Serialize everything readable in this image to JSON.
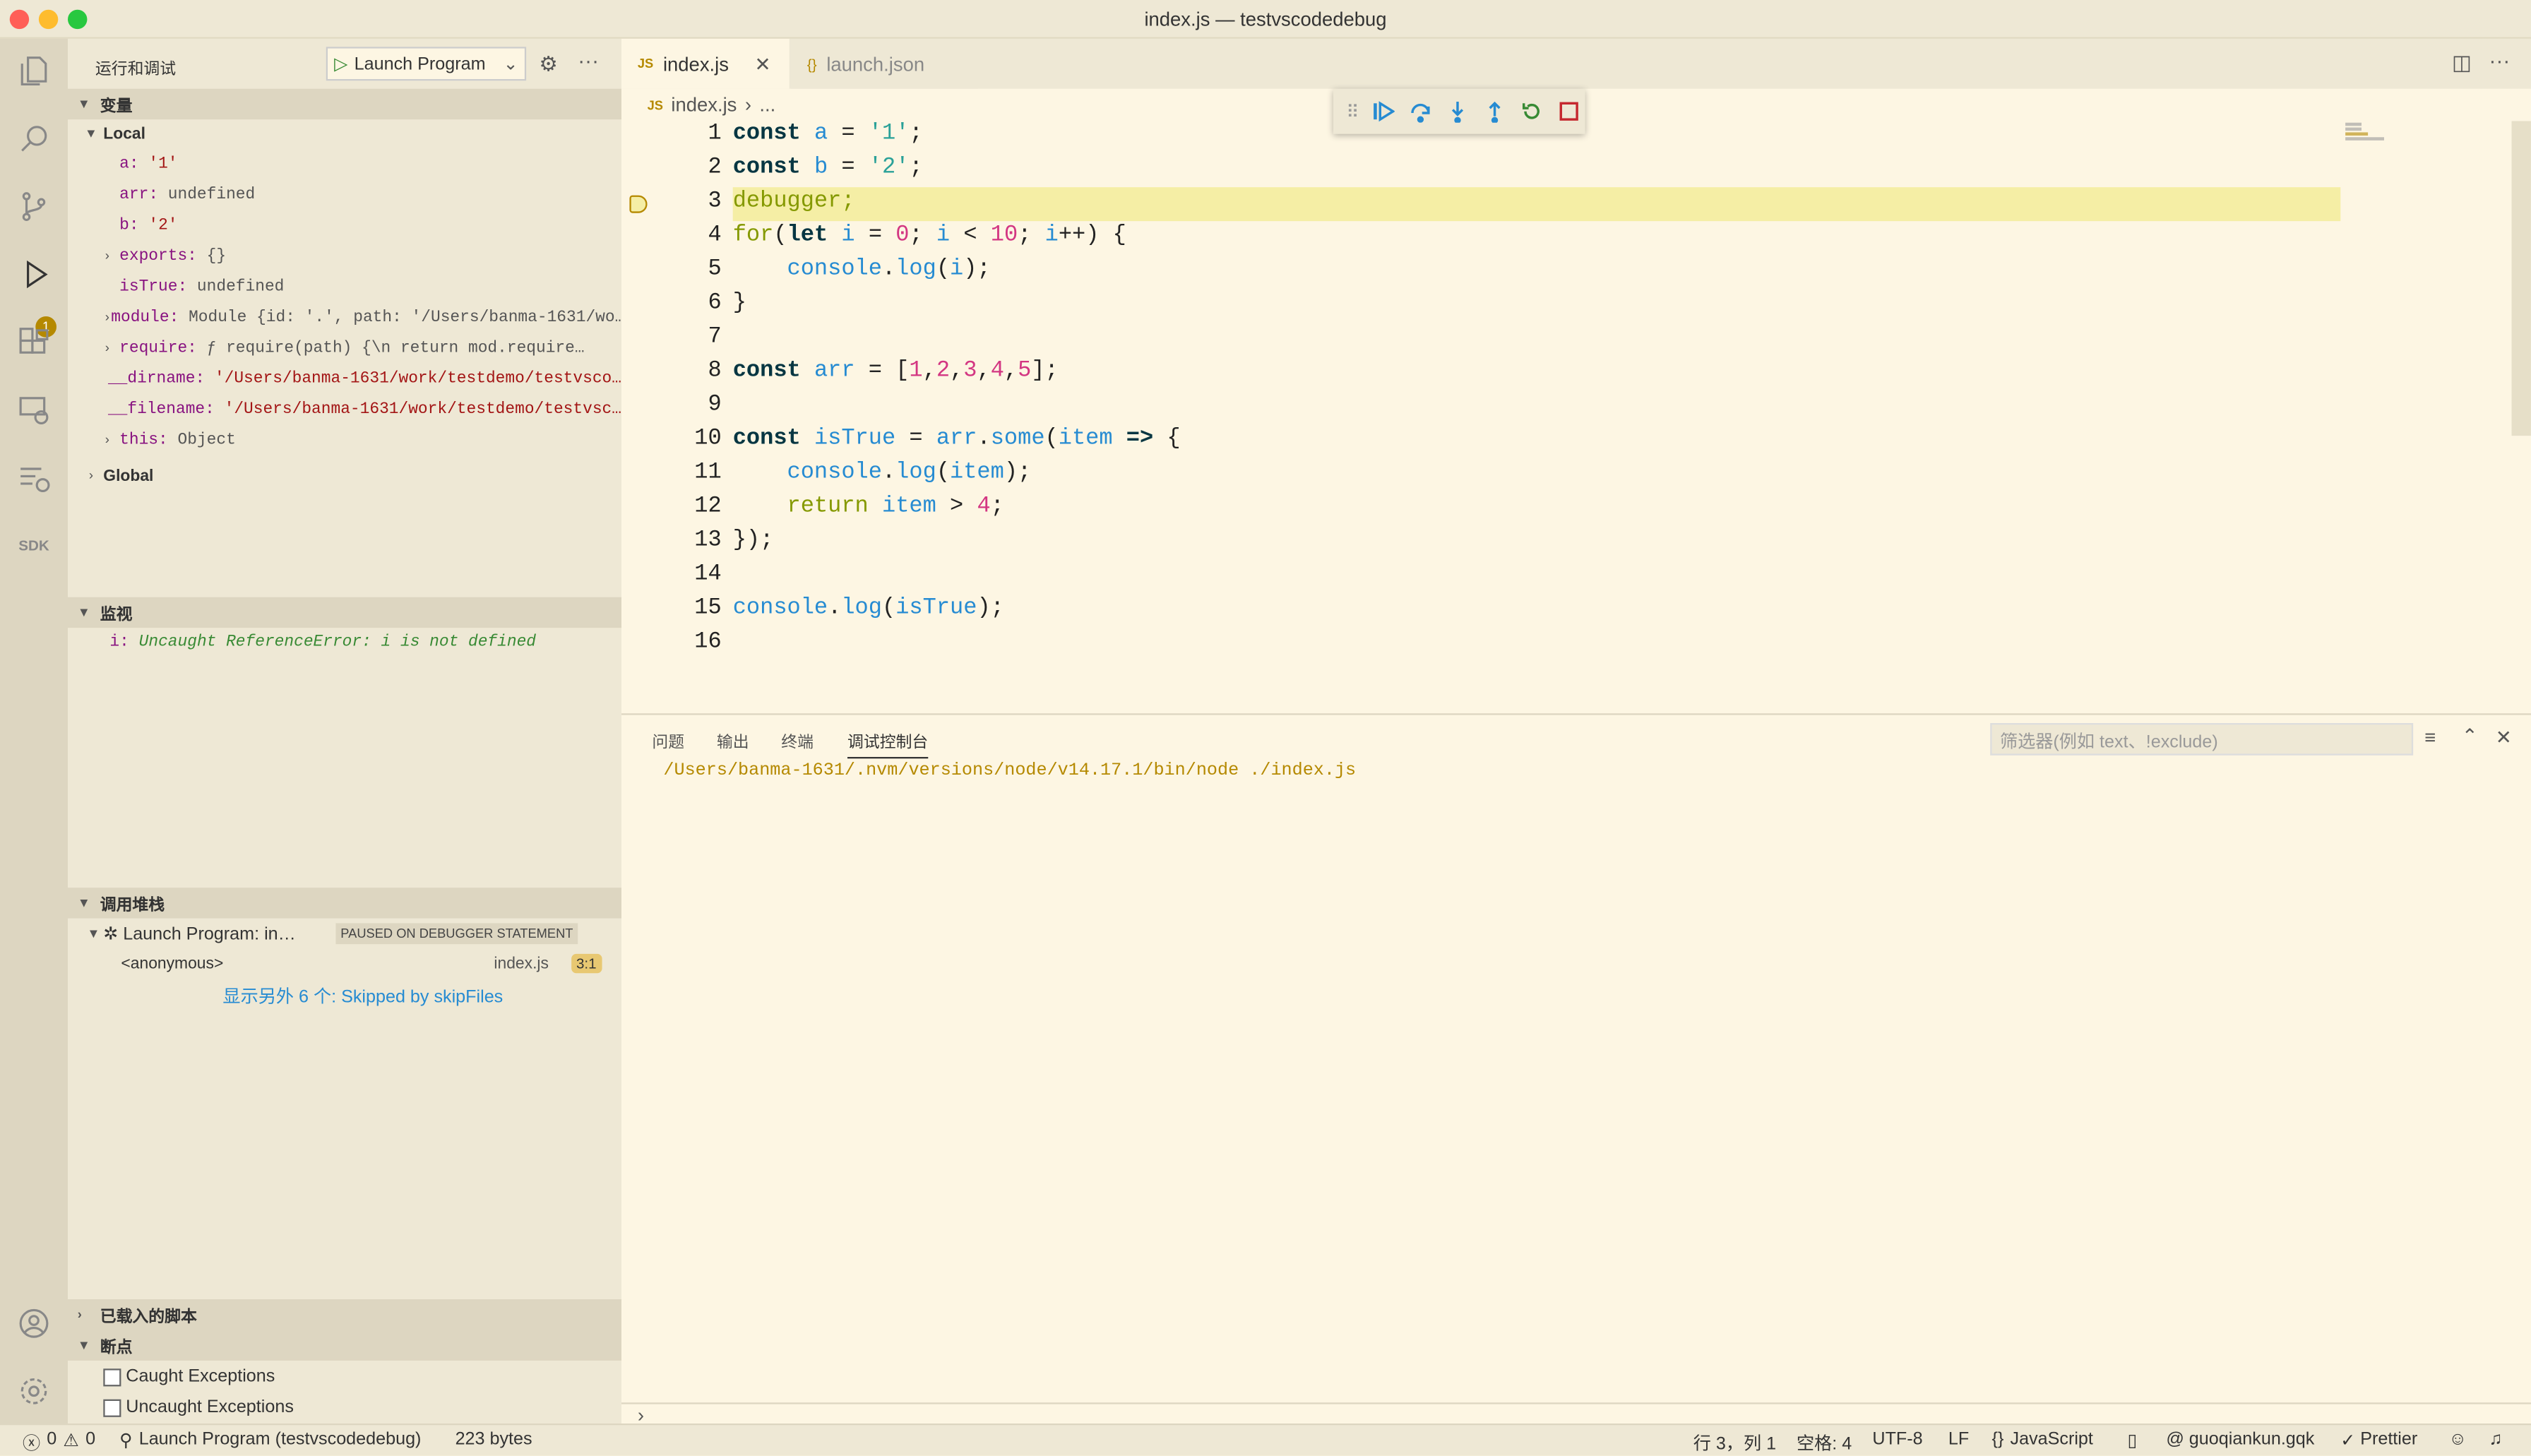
{
  "window": {
    "title": "index.js — testvscodedebug"
  },
  "sidebar": {
    "title": "运行和调试",
    "launch_config": "Launch Program",
    "variables": {
      "header": "变量",
      "local_label": "Local",
      "global_label": "Global",
      "items": [
        {
          "name": "a",
          "value": "'1'"
        },
        {
          "name": "arr",
          "value": "undefined"
        },
        {
          "name": "b",
          "value": "'2'"
        },
        {
          "name": "exports",
          "value": "{}"
        },
        {
          "name": "isTrue",
          "value": "undefined"
        },
        {
          "name": "module",
          "value": "Module {id: '.', path: '/Users/banma-1631/wo…"
        },
        {
          "name": "require",
          "value": "ƒ require(path) {\\n      return mod.require…"
        },
        {
          "name": "__dirname",
          "value": "'/Users/banma-1631/work/testdemo/testvsco…"
        },
        {
          "name": "__filename",
          "value": "'/Users/banma-1631/work/testdemo/testvsc…"
        },
        {
          "name": "this",
          "value": "Object"
        }
      ]
    },
    "watch": {
      "header": "监视",
      "expr": "i",
      "value": "Uncaught ReferenceError: i is not defined"
    },
    "callstack": {
      "header": "调用堆栈",
      "session": "Launch Program: in…",
      "state": "PAUSED ON DEBUGGER STATEMENT",
      "frame_name": "<anonymous>",
      "frame_file": "index.js",
      "frame_pos": "3:1",
      "skipped": "显示另外 6 个: Skipped by skipFiles"
    },
    "loaded_scripts": "已载入的脚本",
    "breakpoints": {
      "header": "断点",
      "caught": "Caught Exceptions",
      "uncaught": "Uncaught Exceptions"
    },
    "debug_badge": "1"
  },
  "editor": {
    "tabs": [
      {
        "icon": "JS",
        "label": "index.js"
      },
      {
        "icon": "{}",
        "label": "launch.json"
      }
    ],
    "breadcrumb": {
      "file": "index.js",
      "rest": "..."
    },
    "line_numbers": [
      "1",
      "2",
      "3",
      "4",
      "5",
      "6",
      "7",
      "8",
      "9",
      "10",
      "11",
      "12",
      "13",
      "14",
      "15",
      "16"
    ]
  },
  "panel": {
    "tabs": [
      "问题",
      "输出",
      "终端",
      "调试控制台"
    ],
    "filter_placeholder": "筛选器(例如 text、!exclude)",
    "console_line": "/Users/banma-1631/.nvm/versions/node/v14.17.1/bin/node ./index.js"
  },
  "status": {
    "errors": "0",
    "warnings": "0",
    "session": "Launch Program (testvscodedebug)",
    "size": "223 bytes",
    "position": "行 3，列 1",
    "spaces": "空格: 4",
    "encoding": "UTF-8",
    "eol": "LF",
    "language": "JavaScript",
    "user": "guoqiankun.gqk",
    "formatter": "Prettier"
  },
  "colors": {
    "accent": "#b58900",
    "current_line": "#f5eea5",
    "string": "#a31515"
  }
}
